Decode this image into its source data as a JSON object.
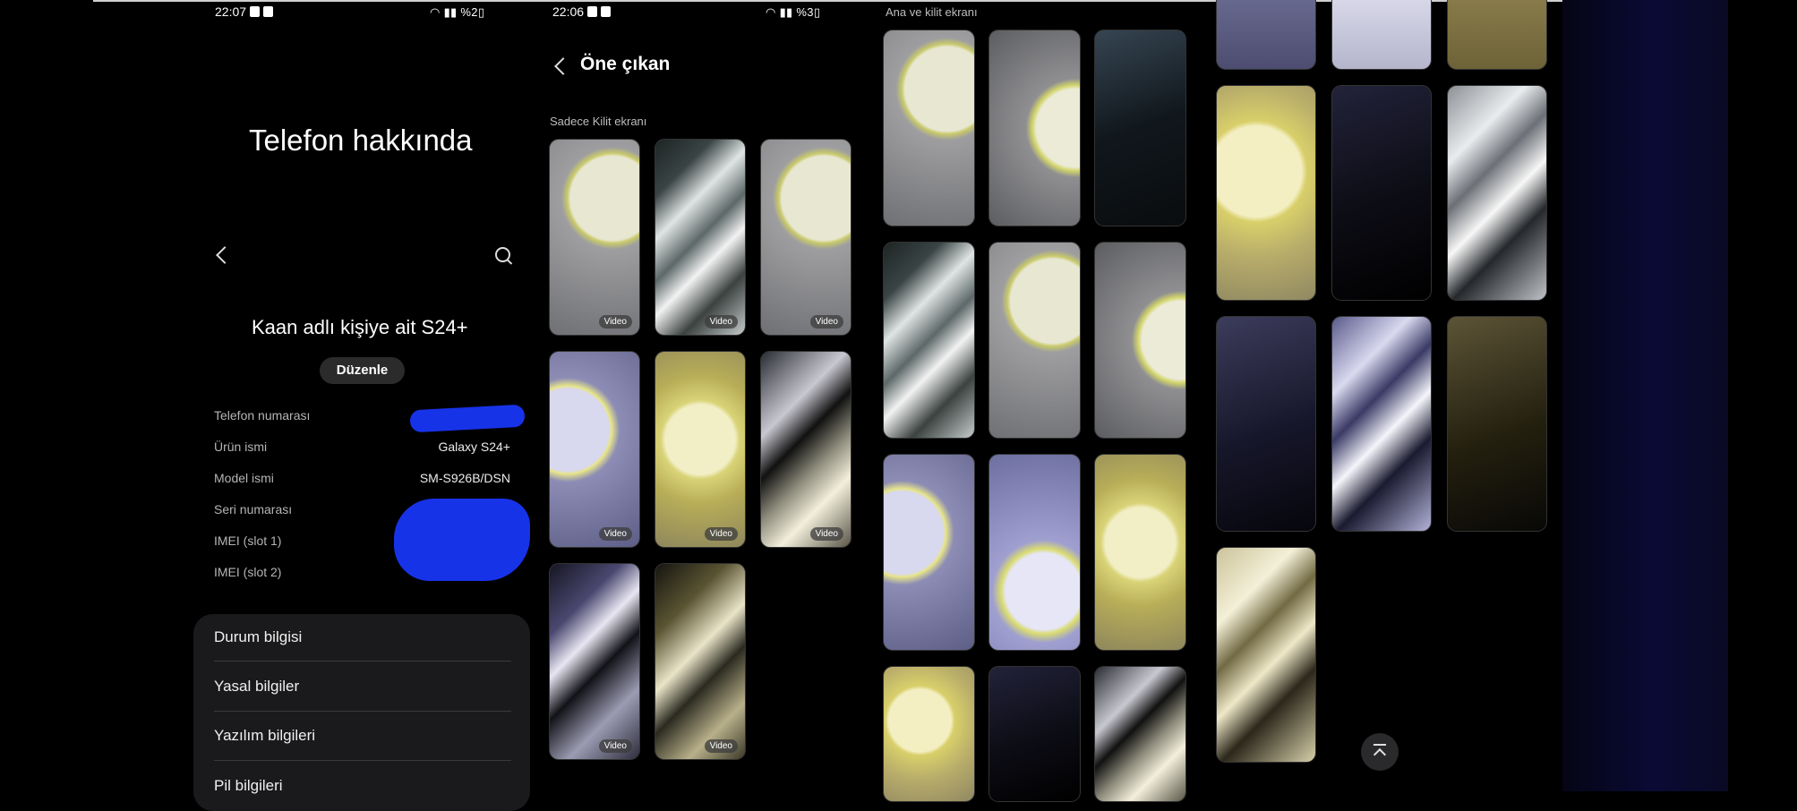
{
  "panel1": {
    "status_time": "22:07",
    "status_battery": "%2",
    "title": "Telefon hakkında",
    "device_name": "Kaan adlı kişiye ait S24+",
    "edit_button": "Düzenle",
    "info": [
      {
        "label": "Telefon numarası",
        "value": ""
      },
      {
        "label": "Ürün ismi",
        "value": "Galaxy S24+"
      },
      {
        "label": "Model ismi",
        "value": "SM-S926B/DSN"
      },
      {
        "label": "Seri numarası",
        "value": ""
      },
      {
        "label": "IMEI (slot 1)",
        "value": ""
      },
      {
        "label": "IMEI (slot 2)",
        "value": ""
      }
    ],
    "menu": [
      "Durum bilgisi",
      "Yasal bilgiler",
      "Yazılım bilgileri",
      "Pil bilgileri"
    ]
  },
  "panel2": {
    "status_time": "22:06",
    "status_battery": "%3",
    "header": "Öne çıkan",
    "section": "Sadece Kilit ekranı",
    "badge": "Video"
  },
  "panel3": {
    "section": "Ana ve kilit ekranı"
  },
  "colors": {
    "background": "#000000",
    "card": "#1a1a1c",
    "scribble": "#1733e8"
  }
}
